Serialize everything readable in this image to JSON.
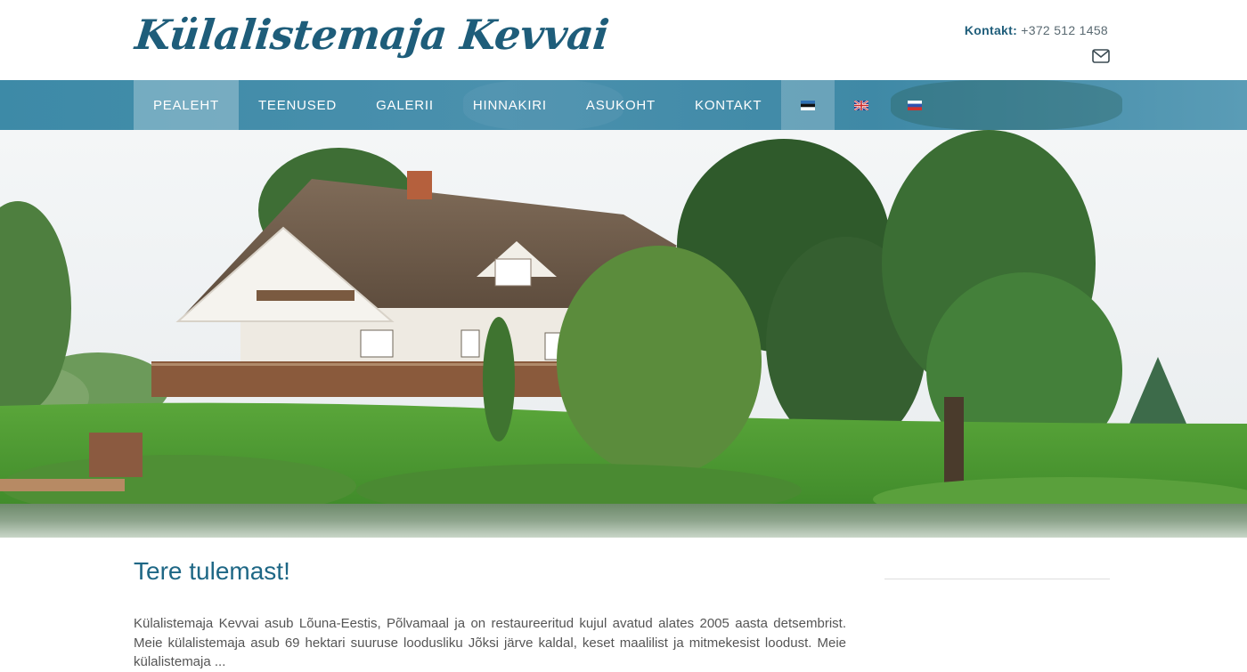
{
  "header": {
    "logo_text": "Külalistemaja Kevvai",
    "contact_label": "Kontakt:",
    "contact_phone": "+372 512 1458",
    "mail_icon": "envelope-icon"
  },
  "nav": {
    "items": [
      {
        "label": "PEALEHT",
        "active": true
      },
      {
        "label": "TEENUSED",
        "active": false
      },
      {
        "label": "GALERII",
        "active": false
      },
      {
        "label": "HINNAKIRI",
        "active": false
      },
      {
        "label": "ASUKOHT",
        "active": false
      },
      {
        "label": "KONTAKT",
        "active": false
      }
    ],
    "languages": [
      {
        "icon": "flag-estonia-icon",
        "active": true
      },
      {
        "icon": "flag-uk-icon",
        "active": false
      },
      {
        "icon": "flag-russia-icon",
        "active": false
      }
    ]
  },
  "hero": {
    "image": "house-by-lake-photo"
  },
  "main": {
    "title": "Tere tulemast!",
    "intro": "Külalistemaja Kevvai asub Lõuna-Eestis, Põlvamaal ja on restaureeritud kujul avatud alates 2005 aasta detsembrist. Meie külalistemaja asub 69 hektari suuruse loodusliku Jõksi järve kaldal, keset maalilist ja mitmekesist loodust. Meie külalistemaja ..."
  },
  "colors": {
    "brand": "#1e5d7a",
    "nav_bg": "#4a90ad",
    "heading": "#1e6785"
  }
}
